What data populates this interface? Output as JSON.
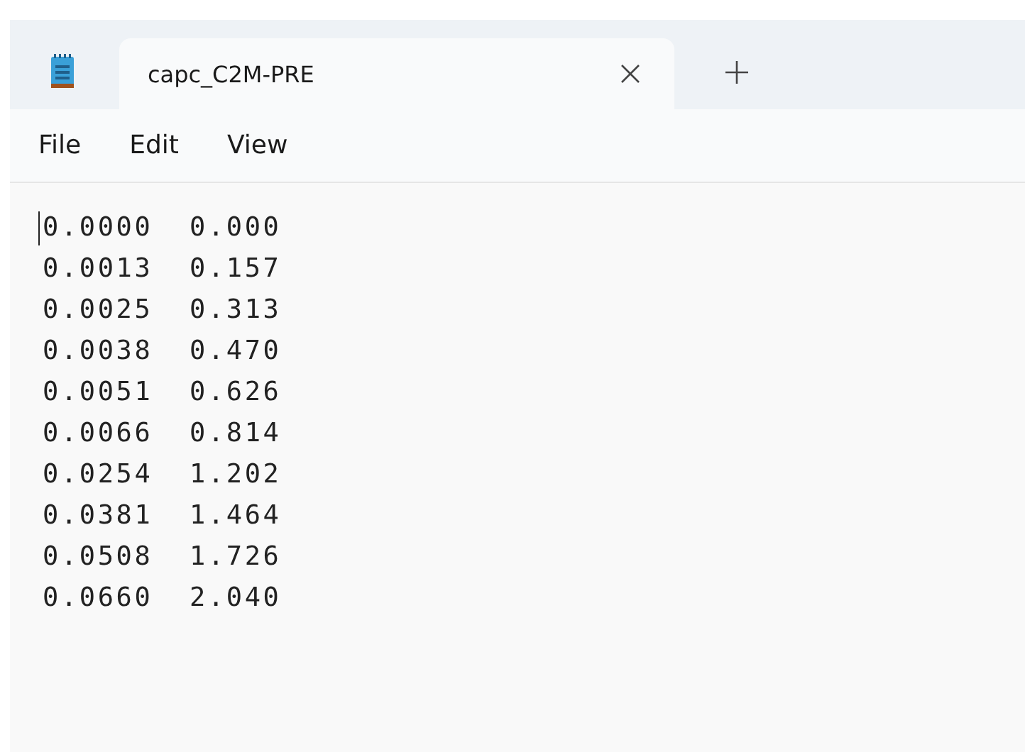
{
  "tabs": [
    {
      "title": "capc_C2M-PRE",
      "selected": true
    }
  ],
  "menu": [
    "File",
    "Edit",
    "View"
  ],
  "lines": [
    "0.0000  0.000",
    "0.0013  0.157",
    "0.0025  0.313",
    "0.0038  0.470",
    "0.0051  0.626",
    "0.0066  0.814",
    "0.0254  1.202",
    "0.0381  1.464",
    "0.0508  1.726",
    "0.0660  2.040"
  ]
}
